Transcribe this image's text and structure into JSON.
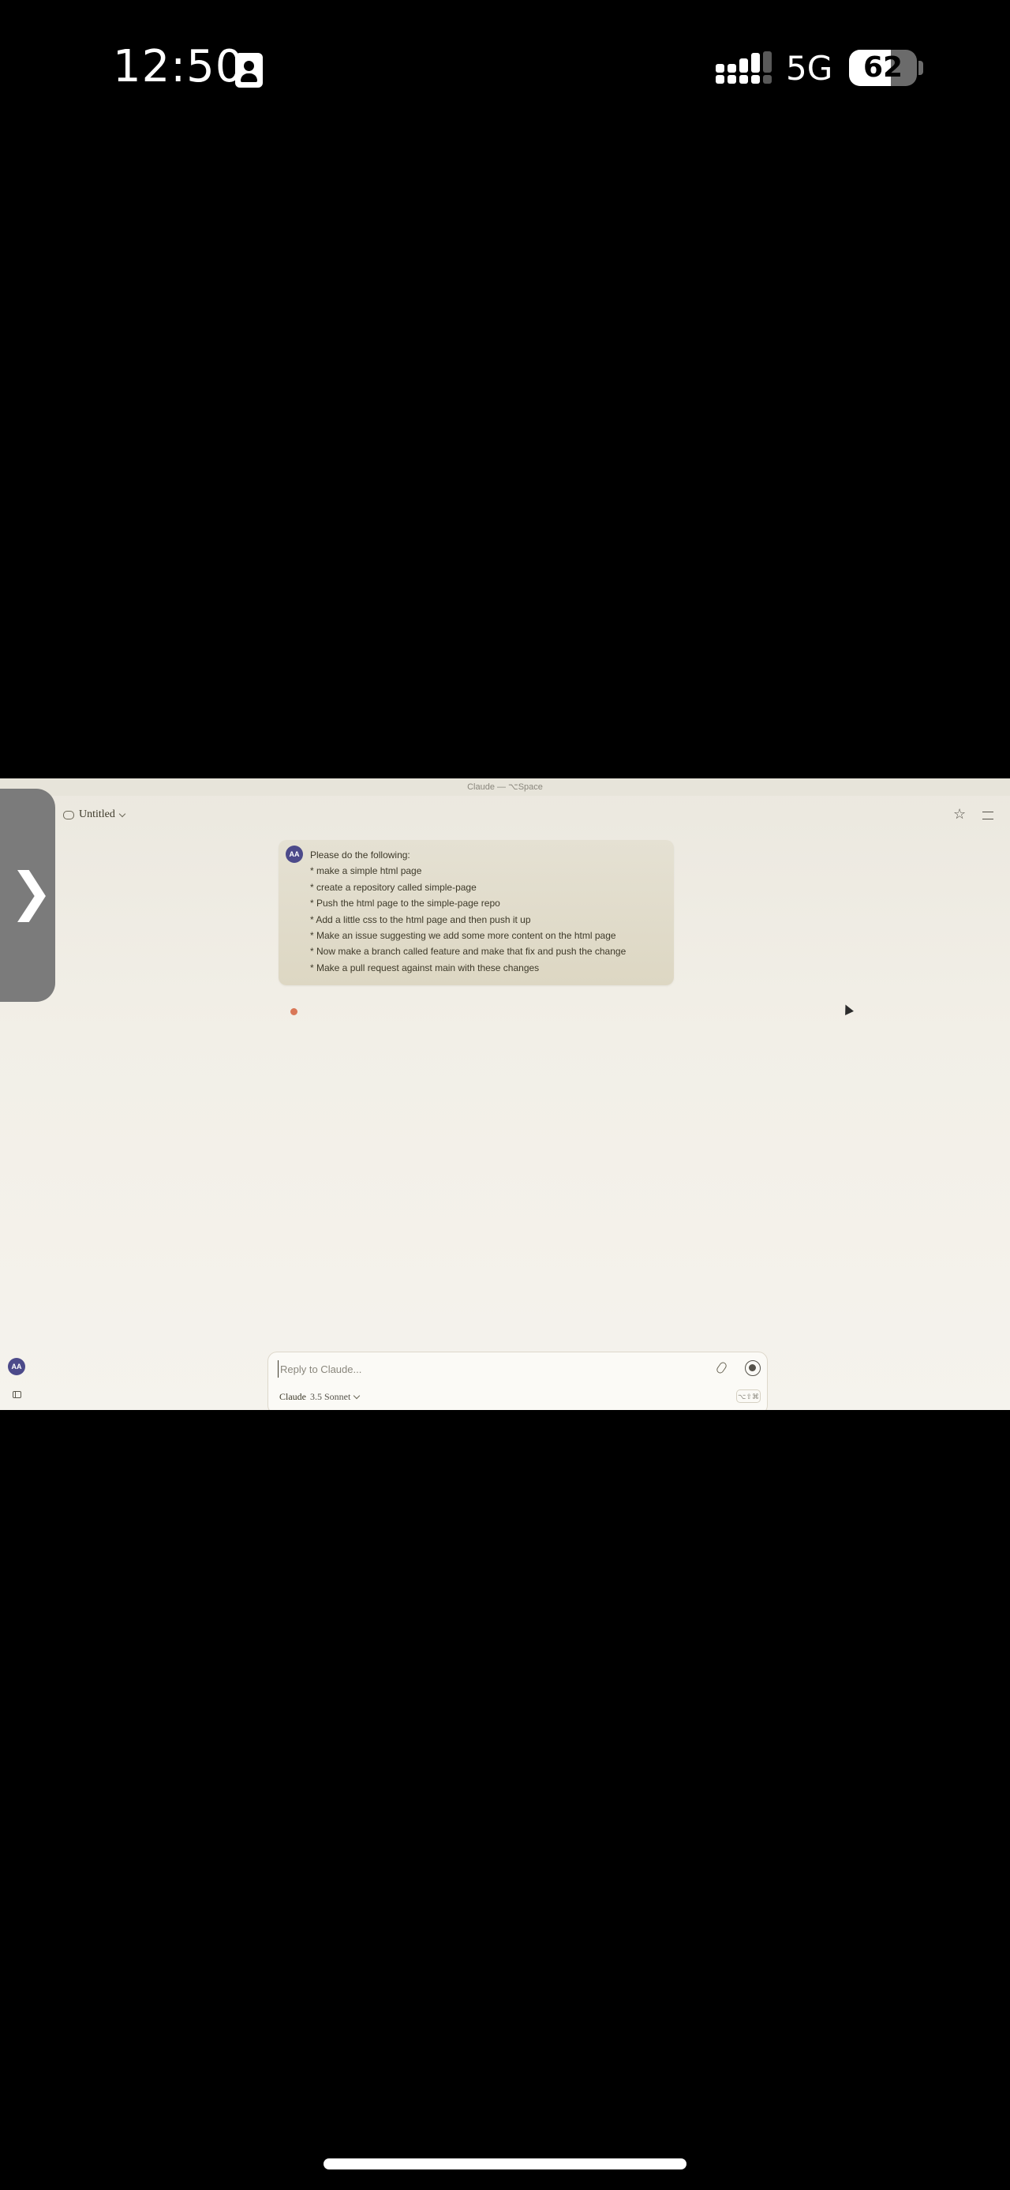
{
  "status_bar": {
    "time": "12:50",
    "network": "5G",
    "battery": "62",
    "battery_level": 0.62,
    "icons": [
      "id-card-icon",
      "signal-bars-icon",
      "battery-icon"
    ]
  },
  "app": {
    "window_title": "Claude — ⌥Space",
    "conversation_title": "Untitled",
    "side_handle_glyph": "❯",
    "message": {
      "avatar": "AA",
      "lines": [
        "Please do the following:",
        "* make a simple html page",
        "* create a repository called simple-page",
        "* Push the html page to the simple-page repo",
        "* Add a little css to the html page and then push it up",
        "* Make an issue suggesting we add some more content on the html page",
        "* Now make a branch called feature and make that fix and push the change",
        "* Make a pull request against main with these changes"
      ]
    },
    "user_avatar": "AA",
    "composer": {
      "placeholder": "Reply to Claude...",
      "model_name": "Claude",
      "model_version": "3.5 Sonnet",
      "shortcut": "⌥⇧⌘"
    },
    "colors": {
      "accent_dot": "#d97757",
      "avatar": "#4c4a8a",
      "message_bg": "#e0dbc9"
    }
  }
}
